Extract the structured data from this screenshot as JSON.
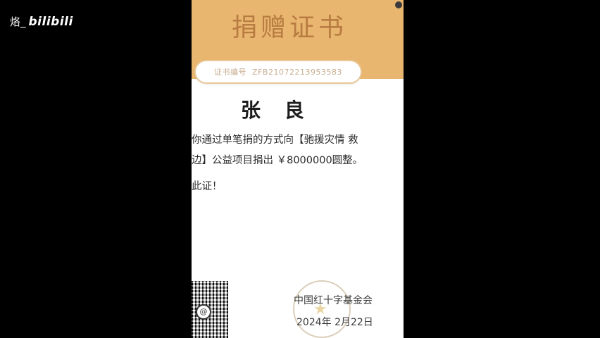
{
  "watermark": {
    "user": "烙_",
    "logo": "bilibili"
  },
  "certificate": {
    "title": "捐赠证书",
    "number_label": "证书编号",
    "number_value": "ZFB21072213953583",
    "donor_name": "张 良",
    "body_lines": [
      "你通过单笔捐的方式向【驰援灾情 救",
      "边】公益项目捐出 ￥8000000圆整。"
    ],
    "closing": "此证！",
    "organization": "中国红十字基金会",
    "date": "2024年 2月22日"
  },
  "colors": {
    "header_band": "#e9b66f",
    "background": "#000000",
    "paper": "#ffffff"
  },
  "icons": {
    "qr": "qr-code-icon",
    "seal": "seal-stamp-icon"
  }
}
